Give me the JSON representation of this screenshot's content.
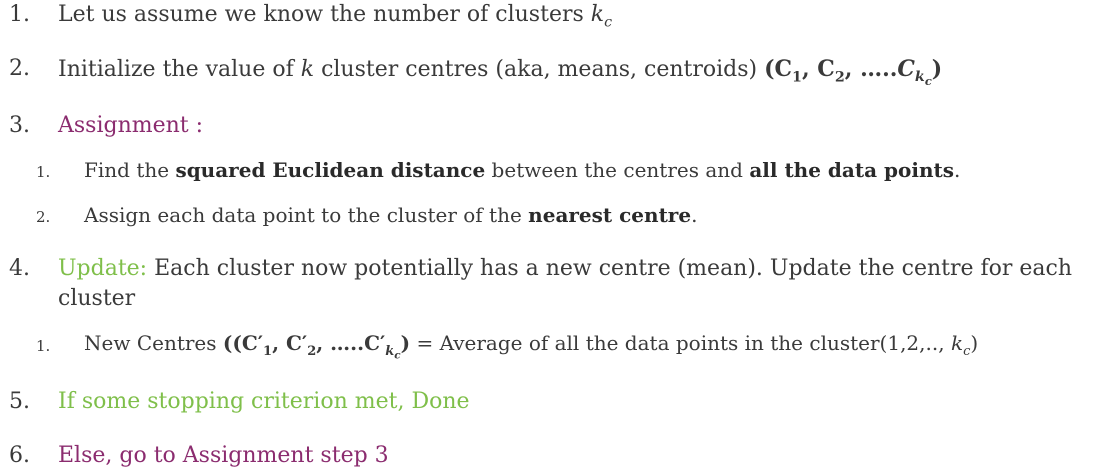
{
  "colors": {
    "purple": "#8b2c6f",
    "green": "#7fbf4a",
    "text": "#3a3a3a"
  },
  "items": [
    {
      "num": "1.",
      "text": "Let us assume we know the number of clusters",
      "math": "k"
    },
    {
      "num": "2.",
      "pre": "Initialize the value of ",
      "k": "k",
      "post": " cluster centres (aka, means, centroids) "
    },
    {
      "num": "3.",
      "label": "Assignment :"
    },
    {
      "num": "4.",
      "label": "Update:",
      "text": " Each cluster now potentially has a new centre (mean). Update the centre for each",
      "text2": "cluster"
    },
    {
      "num": "5.",
      "label": "If some stopping criterion met, Done"
    },
    {
      "num": "6.",
      "label": "Else, go to Assignment step 3"
    }
  ],
  "sub3": [
    {
      "num": "1.",
      "t1": "Find the ",
      "b1": "squared Euclidean distance",
      "t2": " between the centres and ",
      "b2": "all the data points",
      "t3": "."
    },
    {
      "num": "2.",
      "t1": "Assign each data point to the cluster of the ",
      "b1": "nearest centre",
      "t2": "."
    }
  ],
  "sub4": [
    {
      "num": "1.",
      "t1": "New Centres ",
      "t2": " = Average of all the data points in the cluster"
    }
  ]
}
